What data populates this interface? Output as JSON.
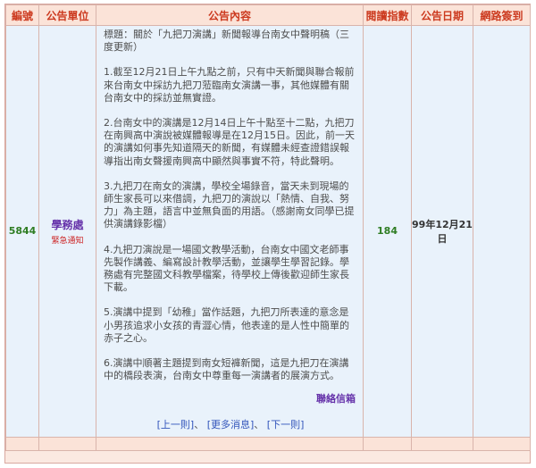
{
  "header": {
    "col_id": "編號",
    "col_unit": "公告單位",
    "col_content": "公告內容",
    "col_reads": "閱讀指數",
    "col_date": "公告日期",
    "col_web": "網路簽到"
  },
  "notice": {
    "id": "5844",
    "unit": "學務處",
    "unit_flag": "緊急通知",
    "title": "標題：關於「九把刀演講」新聞報導台南女中聲明稿（三度更新）",
    "paragraphs": [
      "1.截至12月21日上午九點之前，只有中天新聞與聯合報前來台南女中採訪九把刀蒞臨南女演講一事，其他媒體有關台南女中的採訪並無實證。",
      "2.台南女中的演講是12月14日上午十點至十二點，九把刀在南興高中演說被媒體報導是在12月15日。因此，前一天的演講如何事先知道隔天的新聞，有媒體未經查證錯誤報導指出南女聲援南興高中顯然與事實不符，特此聲明。",
      "3.九把刀在南女的演講，學校全場錄音，當天未到現場的師生家長可以來借調，九把刀的演說以「熱情、自我、努力」為主題，語言中並無負面的用語。（感謝南女同學已提供演講錄影檔）",
      "4.九把刀演說是一場國文教學活動，台南女中國文老師事先製作講義、編寫設計教學活動，並讓學生學習記錄。學務處有完整國文科教學檔案，待學校上傳後歡迎師生家長下載。",
      "5.演講中提到「幼稚」當作話題，九把刀所表達的意念是小男孩追求小女孩的青澀心情，他表達的是人性中簡單的赤子之心。",
      "6.演講中順著主題提到南女短褲新聞，這是九把刀在演講中的橋段表演，台南女中尊重每一演講者的展演方式。"
    ],
    "contact": "聯絡信箱",
    "reads": "184",
    "date": "99年12月21日",
    "web_signin": ""
  },
  "pager": {
    "prev": "上一則",
    "more": "更多消息",
    "next": "下一則",
    "sep": "、"
  },
  "colors": {
    "header_bg": "#fbe3d8",
    "header_text": "#cc3a1f",
    "row_bg": "#e9f2fb",
    "link": "#3355bb",
    "unit": "#6633aa"
  }
}
